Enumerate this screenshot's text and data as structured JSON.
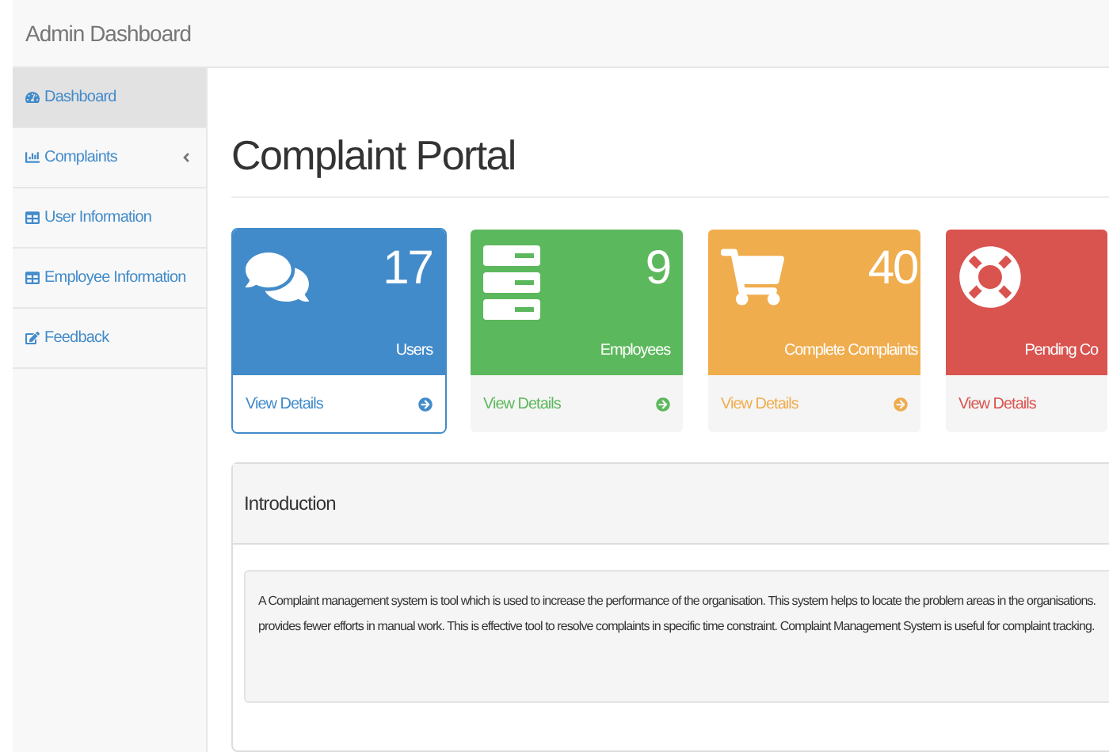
{
  "navbar": {
    "brand": "Admin Dashboard"
  },
  "sidebar": {
    "items": [
      {
        "label": "Dashboard",
        "selected": true,
        "has_submenu": false
      },
      {
        "label": "Complaints",
        "selected": false,
        "has_submenu": true
      },
      {
        "label": "User Information",
        "selected": false,
        "has_submenu": false
      },
      {
        "label": "Employee Information",
        "selected": false,
        "has_submenu": false
      },
      {
        "label": "Feedback",
        "selected": false,
        "has_submenu": false
      }
    ]
  },
  "page_title": "Complaint Portal",
  "cards": [
    {
      "count": "17",
      "label": "Users",
      "link": "View Details",
      "color": "#428bca",
      "selected": true
    },
    {
      "count": "9",
      "label": "Employees",
      "link": "View Details",
      "color": "#5cb85c",
      "selected": false
    },
    {
      "count": "40",
      "label": "Complete Complaints",
      "link": "View Details",
      "color": "#f0ad4e",
      "selected": false
    },
    {
      "label": "Pending Co",
      "link": "View Details",
      "color": "#d9534f",
      "selected": false
    }
  ],
  "introduction": {
    "heading": "Introduction",
    "lines": [
      "A Complaint management system is tool which is used to increase the performance of the organisation. This system helps to locate the problem areas in the organisations.",
      "provides fewer efforts in manual work. This is effective tool to resolve complaints in specific time constraint. Complaint Management System is useful for complaint tracking."
    ]
  }
}
